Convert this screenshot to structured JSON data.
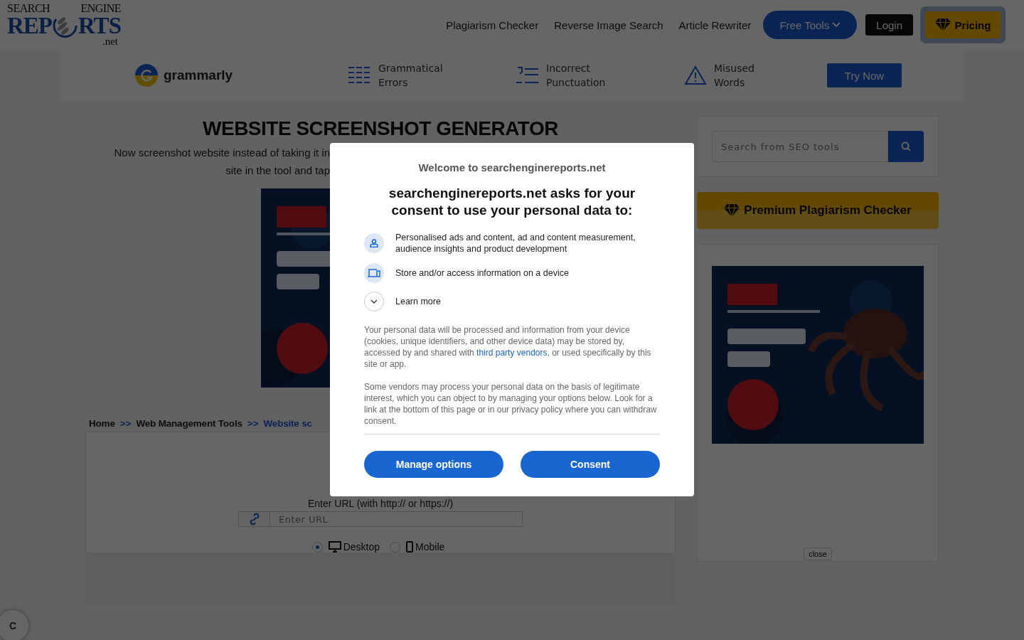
{
  "header": {
    "logo": {
      "top_left": "SEARCH",
      "top_right": "ENGINE",
      "main_left": "REP",
      "main_right": "RTS",
      "suffix": ".net"
    },
    "nav_links": [
      "Plagiarism Checker",
      "Reverse Image Search",
      "Article Rewriter"
    ],
    "free_tools": "Free Tools",
    "login": "Login",
    "pricing": "Pricing"
  },
  "promo_bar": {
    "brand": "grammarly",
    "features": [
      {
        "kind": "lines",
        "lines": [
          "Grammatical",
          "Errors"
        ]
      },
      {
        "kind": "list",
        "lines": [
          "Incorrect",
          "Punctuation"
        ]
      },
      {
        "kind": "warning",
        "lines": [
          "Misused",
          "Words"
        ]
      }
    ],
    "cta": "Try Now"
  },
  "main": {
    "title": "WEBSITE SCREENSHOT GENERATOR",
    "intro": [
      "Now screenshot website instead of taking it in",
      "site in the tool and tap"
    ],
    "breadcrumb": [
      {
        "label": "Home",
        "current": false
      },
      {
        "label": "Web Management Tools",
        "current": false
      },
      {
        "label": "Website sc",
        "current": true
      }
    ],
    "separator": ">>",
    "form": {
      "url_label": "Enter URL (with http:// or https://)",
      "url_placeholder": "Enter URL",
      "devices": [
        {
          "kind": "desktop",
          "label": "Desktop",
          "selected": true
        },
        {
          "kind": "mobile",
          "label": "Mobile",
          "selected": false
        }
      ]
    }
  },
  "sidebar": {
    "search_placeholder": "Search from SEO tools",
    "premium": "Premium Plagiarism Checker",
    "ad_close": "close"
  },
  "corner_button": "C",
  "consent": {
    "welcome": "Welcome to searchenginereports.net",
    "heading": "searchenginereports.net asks for your consent to use your personal data to:",
    "purposes": [
      {
        "kind": "person",
        "text": "Personalised ads and content, ad and content measurement, audience insights and product development"
      },
      {
        "kind": "device",
        "text": "Store and/or access information on a device"
      }
    ],
    "learn_more": "Learn more",
    "expanded": false,
    "paragraphs": [
      {
        "before": "Your personal data will be processed and information from your device (cookies, unique identifiers, and other device data) may be stored by, accessed by and shared with ",
        "link": "third party vendors",
        "after": ", or used specifically by this site or app."
      },
      {
        "before": "Some vendors may process your personal data on the basis of legitimate interest, which you can object to by managing your options below. Look for a link at the bottom of this page or in our privacy policy where you can withdraw consent."
      }
    ],
    "buttons": [
      "Manage options",
      "Consent"
    ]
  }
}
